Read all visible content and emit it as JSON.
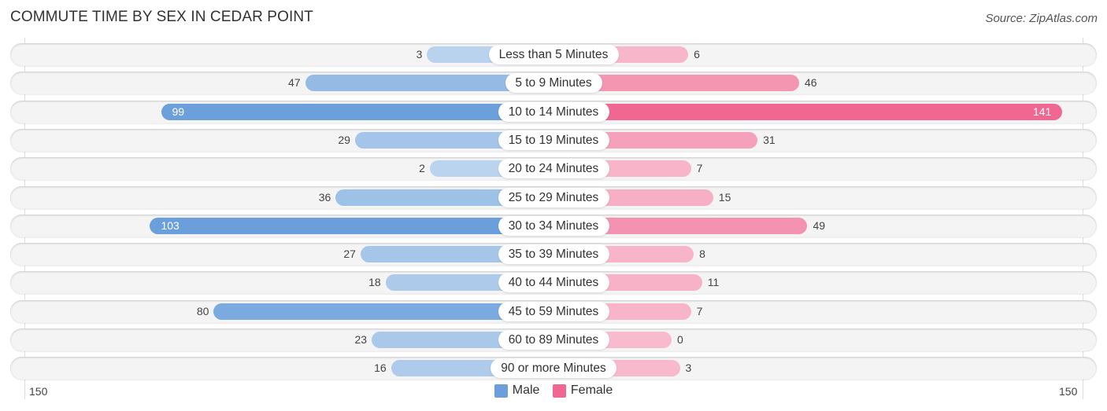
{
  "chart_data": {
    "type": "bar",
    "orientation": "horizontal-diverging",
    "title": "COMMUTE TIME BY SEX IN CEDAR POINT",
    "source": "Source: ZipAtlas.com",
    "categories": [
      "Less than 5 Minutes",
      "5 to 9 Minutes",
      "10 to 14 Minutes",
      "15 to 19 Minutes",
      "20 to 24 Minutes",
      "25 to 29 Minutes",
      "30 to 34 Minutes",
      "35 to 39 Minutes",
      "40 to 44 Minutes",
      "45 to 59 Minutes",
      "60 to 89 Minutes",
      "90 or more Minutes"
    ],
    "series": [
      {
        "name": "Male",
        "color": "#6a9fdb",
        "values": [
          3,
          47,
          99,
          29,
          2,
          36,
          103,
          27,
          18,
          80,
          23,
          16
        ]
      },
      {
        "name": "Female",
        "color": "#f06892",
        "values": [
          6,
          46,
          141,
          31,
          7,
          15,
          49,
          8,
          11,
          7,
          0,
          3
        ]
      }
    ],
    "axis": {
      "left_tick": "150",
      "right_tick": "150",
      "max": 150
    },
    "legend": {
      "position": "bottom-center",
      "items": [
        {
          "label": "Male",
          "color": "#6a9fdb"
        },
        {
          "label": "Female",
          "color": "#f06892"
        }
      ]
    }
  }
}
